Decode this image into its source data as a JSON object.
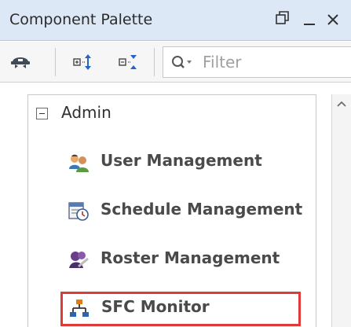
{
  "window": {
    "title": "Component Palette",
    "controls": [
      "restore-icon",
      "minimize-icon",
      "close-icon"
    ]
  },
  "toolbar": {
    "buttons": [
      "user-hat-icon",
      "expand-all-icon",
      "collapse-all-icon"
    ],
    "filter": {
      "placeholder": "Filter",
      "value": ""
    }
  },
  "tree": {
    "group": {
      "label": "Admin",
      "expanded": true
    },
    "items": [
      {
        "label": "User Management",
        "icon": "users-icon"
      },
      {
        "label": "Schedule Management",
        "icon": "schedule-icon"
      },
      {
        "label": "Roster Management",
        "icon": "roster-icon"
      },
      {
        "label": "SFC Monitor",
        "icon": "sfc-chart-icon",
        "highlighted": true
      }
    ]
  },
  "colors": {
    "titlebar_bg": "#dde8f6",
    "highlight_border": "#e0393a"
  }
}
